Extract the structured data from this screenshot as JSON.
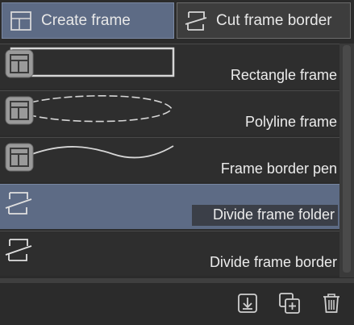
{
  "tabs": [
    {
      "label": "Create frame",
      "icon": "frame-create-icon",
      "active": true
    },
    {
      "label": "Cut frame border",
      "icon": "cut-frame-border-icon",
      "active": false
    }
  ],
  "items": [
    {
      "label": "Rectangle frame",
      "icon": "frame-tool-icon",
      "preview": "rectangle"
    },
    {
      "label": "Polyline frame",
      "icon": "frame-tool-icon",
      "preview": "polyline"
    },
    {
      "label": "Frame border pen",
      "icon": "frame-tool-icon",
      "preview": "pen-curve"
    },
    {
      "label": "Divide frame folder",
      "icon": "divide-frame-icon",
      "selected": true
    },
    {
      "label": "Divide frame border",
      "icon": "divide-frame-icon"
    }
  ],
  "footer": {
    "buttons": [
      {
        "icon": "import-icon"
      },
      {
        "icon": "duplicate-icon"
      },
      {
        "icon": "trash-icon"
      }
    ]
  },
  "colors": {
    "background": "#2b2b2b",
    "selected": "#5d6b85",
    "text": "#ececec"
  }
}
